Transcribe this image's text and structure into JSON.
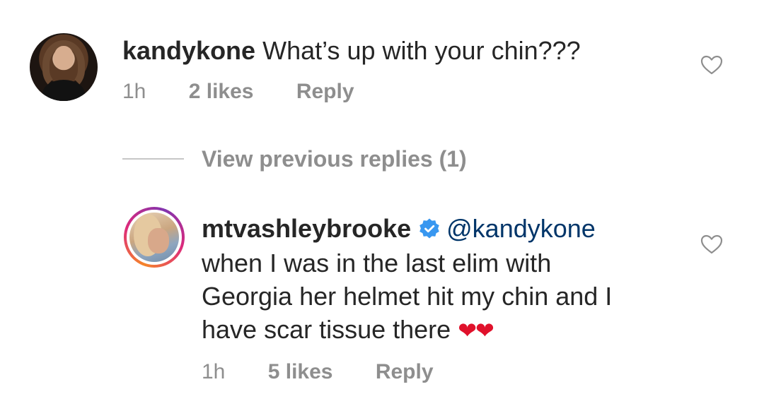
{
  "comments": [
    {
      "username": "kandykone",
      "text": "What’s up with your chin???",
      "time": "1h",
      "likes": "2 likes",
      "reply": "Reply"
    },
    {
      "username": "mtvashleybrooke",
      "mention": "@kandykone",
      "lines": [
        "when I was in the last elim with",
        "Georgia her helmet hit my chin and I",
        "have scar tissue there"
      ],
      "emoji": "❤❤",
      "time": "1h",
      "likes": "5 likes",
      "reply": "Reply"
    }
  ],
  "view_previous_replies": "View previous replies (1)",
  "icons": {
    "like": "heart-outline-icon",
    "verified": "verified-badge-icon",
    "ring": "story-ring"
  },
  "colors": {
    "text": "#262626",
    "secondary": "#8e8e8e",
    "verified": "#3897f0",
    "mention": "#003569",
    "heart_emoji": "#e0112b"
  }
}
